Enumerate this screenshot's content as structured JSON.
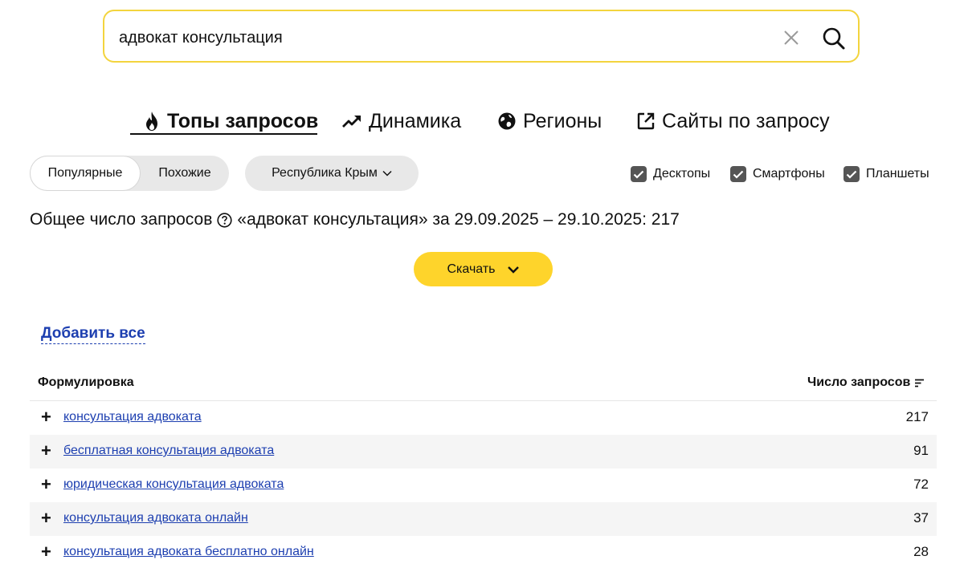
{
  "search": {
    "value": "адвокат консультация",
    "clear_icon": "close-icon",
    "search_icon": "magnifier-icon"
  },
  "tabs": [
    {
      "label": "Топы запросов",
      "icon": "fire-icon",
      "active": true
    },
    {
      "label": "Динамика",
      "icon": "trend-up-icon",
      "active": false
    },
    {
      "label": "Регионы",
      "icon": "globe-icon",
      "active": false
    },
    {
      "label": "Сайты по запросу",
      "icon": "external-link-icon",
      "active": false
    }
  ],
  "mode": {
    "popular": "Популярные",
    "similar": "Похожие",
    "selected": "popular"
  },
  "region": {
    "label": "Республика Крым",
    "icon": "chevron-down-icon"
  },
  "devices": [
    {
      "label": "Десктопы",
      "checked": true
    },
    {
      "label": "Смартфоны",
      "checked": true
    },
    {
      "label": "Планшеты",
      "checked": true
    }
  ],
  "summary": {
    "prefix": "Общее число запросов",
    "suffix": "«адвокат консультация» за 29.09.2025 – 29.10.2025: 217"
  },
  "download": {
    "label": "Скачать"
  },
  "add_all": "Добавить все",
  "table": {
    "col_query": "Формулировка",
    "col_count": "Число запросов",
    "rows": [
      {
        "query": "консультация адвоката",
        "count": "217"
      },
      {
        "query": "бесплатная консультация адвоката",
        "count": "91"
      },
      {
        "query": "юридическая консультация адвоката",
        "count": "72"
      },
      {
        "query": "консультация адвоката онлайн",
        "count": "37"
      },
      {
        "query": "консультация адвоката бесплатно онлайн",
        "count": "28"
      }
    ]
  },
  "colors": {
    "accent_yellow": "#fed42b",
    "search_border": "#f3d43e",
    "link_blue": "#1d3fb0"
  }
}
